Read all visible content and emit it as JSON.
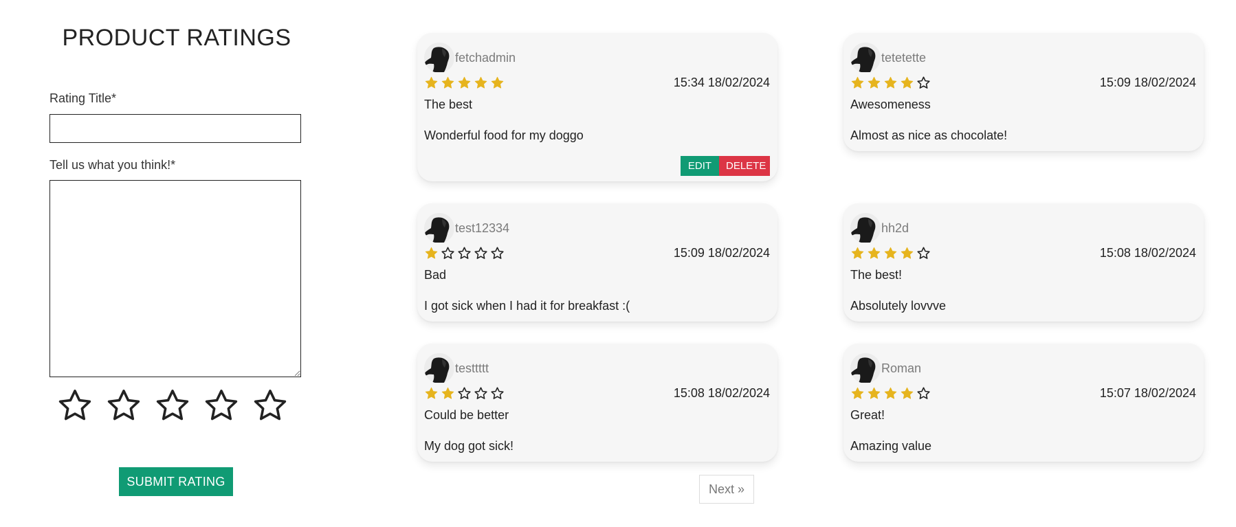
{
  "form": {
    "heading": "PRODUCT RATINGS",
    "title_label": "Rating Title*",
    "title_value": "",
    "body_label": "Tell us what you think!*",
    "body_value": "",
    "star_count": 5,
    "selected_rating": 0,
    "submit_label": "SUBMIT RATING"
  },
  "colors": {
    "accent_green": "#109b74",
    "delete_red": "#dc3545",
    "star_gold": "#e6b41e",
    "card_bg": "#f6f6f6"
  },
  "reviews": [
    {
      "username": "fetchadmin",
      "rating": 5,
      "timestamp": "15:34 18/02/2024",
      "title": "The best",
      "body": "Wonderful food for my doggo",
      "edit_label": "EDIT",
      "delete_label": "DELETE"
    },
    {
      "username": "tetetette",
      "rating": 4,
      "timestamp": "15:09 18/02/2024",
      "title": "Awesomeness",
      "body": "Almost as nice as chocolate!"
    },
    {
      "username": "test12334",
      "rating": 1,
      "timestamp": "15:09 18/02/2024",
      "title": "Bad",
      "body": "I got sick when I had it for breakfast :("
    },
    {
      "username": "hh2d",
      "rating": 4,
      "timestamp": "15:08 18/02/2024",
      "title": "The best!",
      "body": "Absolutely lovvve"
    },
    {
      "username": "testtttt",
      "rating": 2,
      "timestamp": "15:08 18/02/2024",
      "title": "Could be better",
      "body": "My dog got sick!"
    },
    {
      "username": "Roman",
      "rating": 4,
      "timestamp": "15:07 18/02/2024",
      "title": "Great!",
      "body": "Amazing value"
    }
  ],
  "pagination": {
    "next_label": "Next »"
  },
  "icons": {
    "avatar": "dog-avatar-icon",
    "star_filled": "star-filled-icon",
    "star_empty": "star-outline-icon",
    "resize": "resize-handle-icon"
  }
}
